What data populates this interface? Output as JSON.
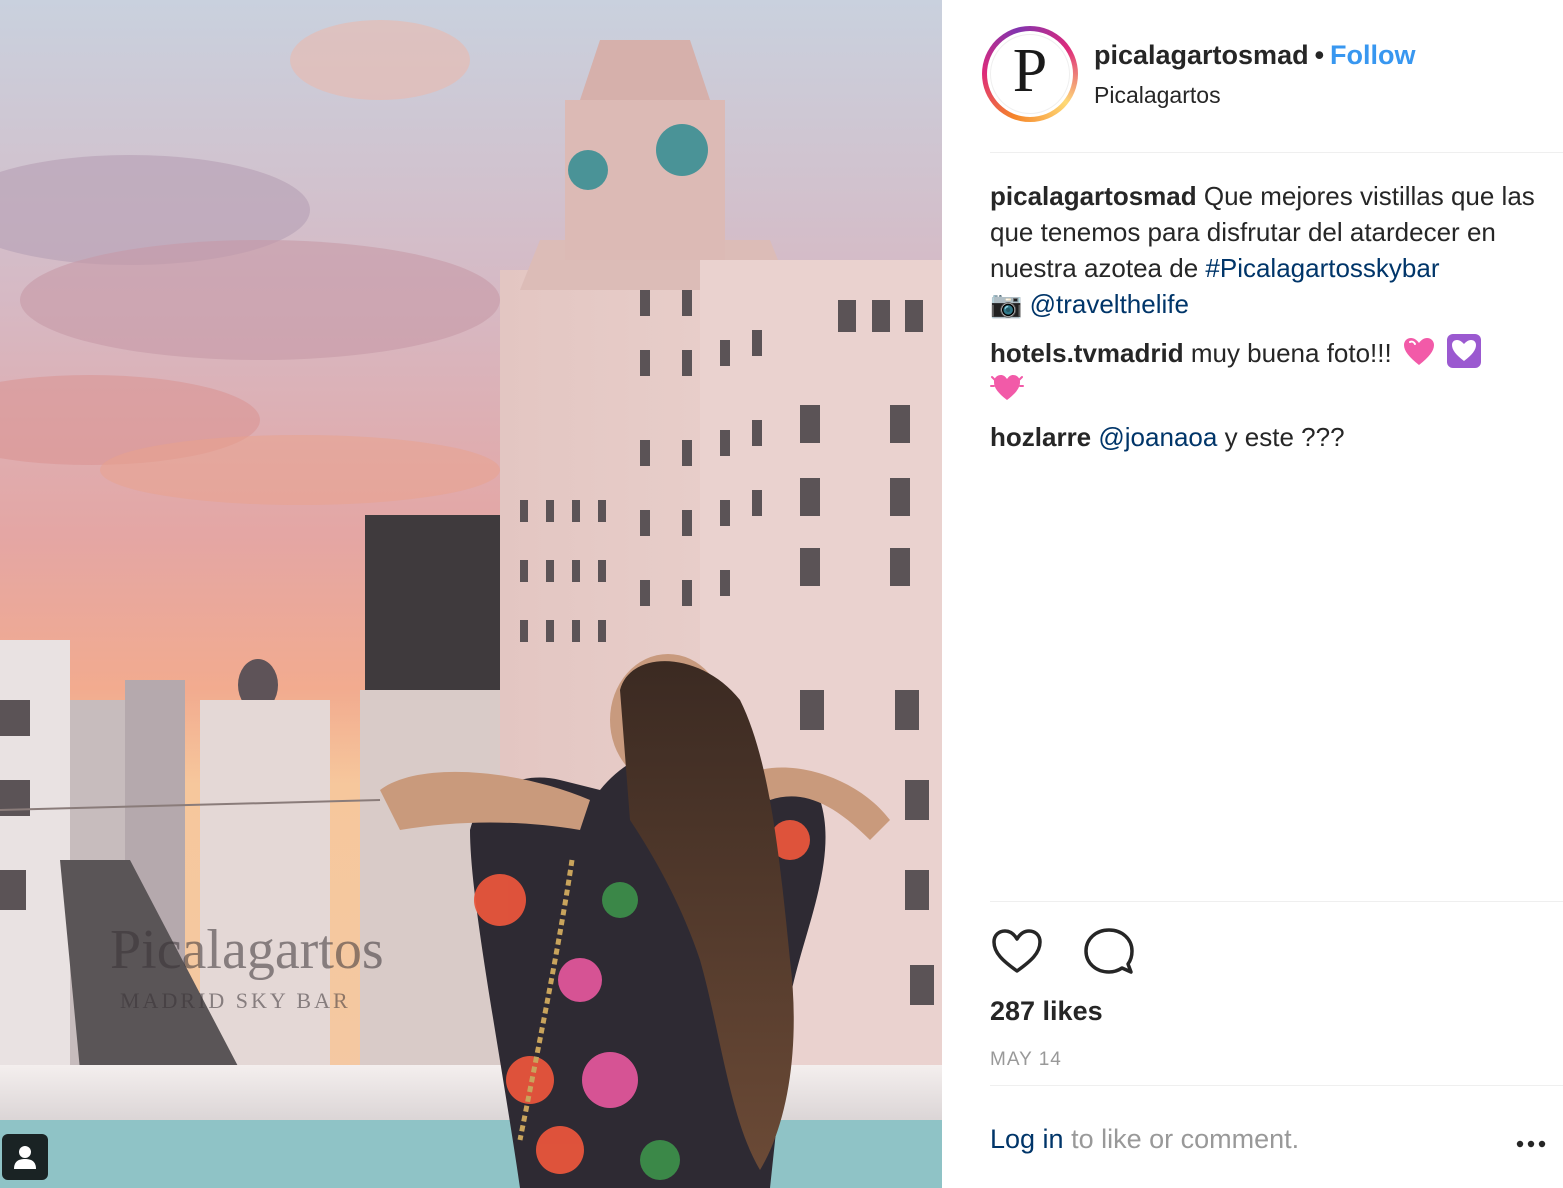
{
  "photo": {
    "watermark_title": "Picalagartos",
    "watermark_subtitle": "MADRID SKY BAR",
    "tagged_icon": "user-tag-icon"
  },
  "post_header": {
    "avatar_letter": "P",
    "username": "picalagartosmad",
    "separator": "•",
    "follow_label": "Follow",
    "location": "Picalagartos"
  },
  "comments": [
    {
      "user": "picalagartosmad",
      "text_1": "Que mejores vistillas que las que tenemos para disfrutar del atardecer en nuestra azotea de",
      "hashtag": "#Picalagartosskybar",
      "camera_emoji": "📷",
      "mention": "@travelthelife"
    },
    {
      "user": "hotels.tvmadrid",
      "text": "muy buena foto!!!",
      "emojis": [
        "heart-pink-icon",
        "heart-purple-icon",
        "heart-pink-glow-icon"
      ]
    },
    {
      "user": "hozlarre",
      "mention": "@joanaoa",
      "text": "y este ???"
    }
  ],
  "actions": {
    "like_icon": "heart-outline-icon",
    "comment_icon": "comment-bubble-icon"
  },
  "likes": "287 likes",
  "date": "MAY 14",
  "footer": {
    "login_label": "Log in",
    "login_suffix": "to like or comment.",
    "more_icon": "more-options-icon"
  },
  "colors": {
    "accent_blue": "#3897f0",
    "link_dark_blue": "#003569",
    "muted_gray": "#999999",
    "text": "#262626"
  }
}
